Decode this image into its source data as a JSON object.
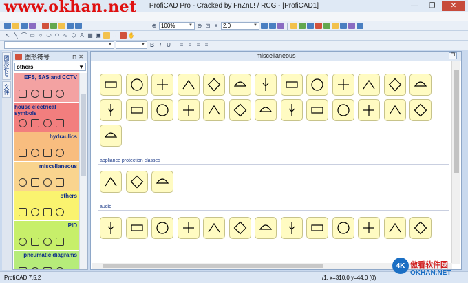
{
  "window": {
    "title": "ProfiCAD Pro - Cracked by FnZnL! / RCG - [ProfiCAD1]",
    "watermark": "www.okhan.net",
    "minimize": "—",
    "maximize": "❐",
    "close": "✕"
  },
  "toolbar": {
    "zoom_value": "100%",
    "line_width_value": "2.0"
  },
  "left_tabs": [
    "图形符号",
    "文件"
  ],
  "panel": {
    "title": "图形符号",
    "category_select": "others",
    "categories": [
      {
        "label": "EFS, SAS and CCTV",
        "color": "#f3a2a2"
      },
      {
        "label": "house electrical symbols",
        "color": "#f27e7e"
      },
      {
        "label": "hydraulics",
        "color": "#f8bd7f"
      },
      {
        "label": "miscellaneous",
        "color": "#f9d48e"
      },
      {
        "label": "others",
        "color": "#faf36f"
      },
      {
        "label": "PID",
        "color": "#c7ef6a"
      },
      {
        "label": "pneumatic diagrams",
        "color": "#b6ec7a"
      }
    ]
  },
  "document": {
    "title": "miscellaneous",
    "sections": [
      {
        "label": "",
        "count": 27
      },
      {
        "label": "appliance protection classes",
        "count": 3
      },
      {
        "label": "audio",
        "count": 13
      }
    ]
  },
  "status": {
    "version": "ProfiCAD 7.5.2",
    "coords": "/1.  x=310.0  y=44.0 (0)"
  },
  "logo": {
    "badge": "4K",
    "chinese": "傲看软件园",
    "english": "OKHAN.NET"
  }
}
